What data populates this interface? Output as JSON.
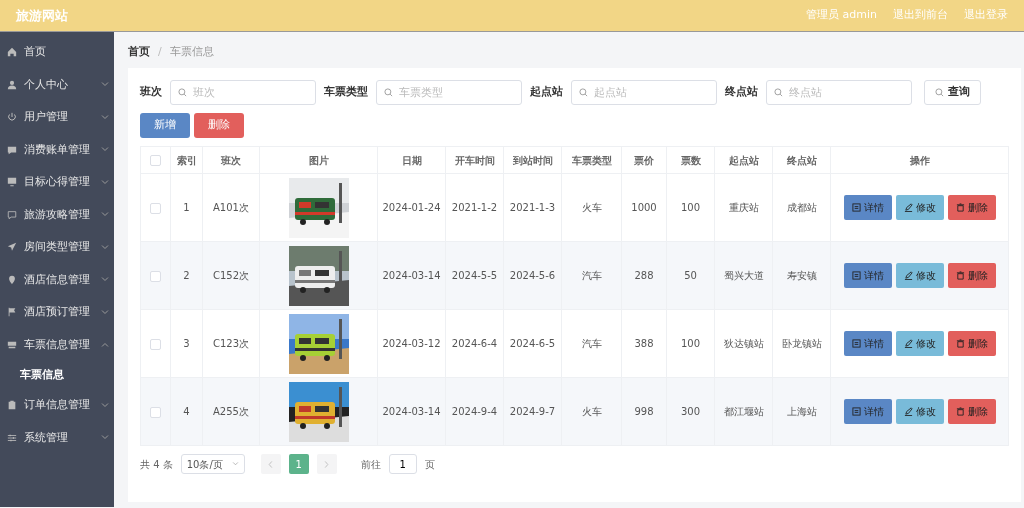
{
  "header": {
    "title": "旅游网站",
    "links": [
      "管理员 admin",
      "退出到前台",
      "退出登录"
    ]
  },
  "sidebar": {
    "items": [
      {
        "label": "首页"
      },
      {
        "label": "个人中心",
        "expanded": false
      },
      {
        "label": "用户管理",
        "expanded": false
      },
      {
        "label": "消费账单管理",
        "expanded": false
      },
      {
        "label": "目标心得管理",
        "expanded": false
      },
      {
        "label": "旅游攻略管理",
        "expanded": false
      },
      {
        "label": "房间类型管理",
        "expanded": false
      },
      {
        "label": "酒店信息管理",
        "expanded": false
      },
      {
        "label": "酒店预订管理",
        "expanded": false
      },
      {
        "label": "车票信息管理",
        "expanded": true,
        "children": [
          {
            "label": "车票信息",
            "selected": true
          }
        ]
      },
      {
        "label": "订单信息管理",
        "expanded": false
      },
      {
        "label": "系统管理",
        "expanded": false
      }
    ]
  },
  "breadcrumb": {
    "items": [
      "首页",
      "车票信息"
    ],
    "separator": "/"
  },
  "filters": [
    {
      "label": "班次",
      "placeholder": "班次"
    },
    {
      "label": "车票类型",
      "placeholder": "车票类型"
    },
    {
      "label": "起点站",
      "placeholder": "起点站"
    },
    {
      "label": "终点站",
      "placeholder": "终点站"
    }
  ],
  "search_button": "查询",
  "toolbar": [
    {
      "label": "新增",
      "kind": "add"
    },
    {
      "label": "删除",
      "kind": "delete"
    }
  ],
  "table": {
    "select_all_checked": false,
    "columns": [
      "",
      "索引",
      "班次",
      "图片",
      "日期",
      "开车时间",
      "到站时间",
      "车票类型",
      "票价",
      "票数",
      "起点站",
      "终点站",
      "操作"
    ],
    "rows": [
      {
        "checked": false,
        "cells": [
          "",
          "1",
          "A101次",
          "",
          "2024-01-24",
          "2021-1-2",
          "2021-1-3",
          "火车",
          "1000",
          "100",
          "重庆站",
          "成都站"
        ],
        "actions": [
          {
            "label": "详情",
            "kind": "detail"
          },
          {
            "label": "修改",
            "kind": "edit"
          },
          {
            "label": "删除",
            "kind": "delete"
          }
        ]
      },
      {
        "checked": false,
        "cells": [
          "",
          "2",
          "C152次",
          "",
          "2024-03-14",
          "2024-5-5",
          "2024-5-6",
          "汽车",
          "288",
          "50",
          "蜀兴大道",
          "寿安镇"
        ],
        "actions": [
          {
            "label": "详情",
            "kind": "detail"
          },
          {
            "label": "修改",
            "kind": "edit"
          },
          {
            "label": "删除",
            "kind": "delete"
          }
        ]
      },
      {
        "checked": false,
        "cells": [
          "",
          "3",
          "C123次",
          "",
          "2024-03-12",
          "2024-6-4",
          "2024-6-5",
          "汽车",
          "388",
          "100",
          "狄达镇站",
          "卧龙镇站"
        ],
        "actions": [
          {
            "label": "详情",
            "kind": "detail"
          },
          {
            "label": "修改",
            "kind": "edit"
          },
          {
            "label": "删除",
            "kind": "delete"
          }
        ]
      },
      {
        "checked": false,
        "cells": [
          "",
          "4",
          "A255次",
          "",
          "2024-03-14",
          "2024-9-4",
          "2024-9-7",
          "火车",
          "998",
          "300",
          "都江堰站",
          "上海站"
        ],
        "actions": [
          {
            "label": "详情",
            "kind": "detail"
          },
          {
            "label": "修改",
            "kind": "edit"
          },
          {
            "label": "删除",
            "kind": "delete"
          }
        ]
      }
    ]
  },
  "pagination": {
    "total": "共 4 条",
    "page_size": "10条/页",
    "pages": [
      {
        "label": "1",
        "selected": true
      }
    ],
    "goto_label": "前往",
    "goto_value": "1",
    "goto_suffix": "页"
  }
}
